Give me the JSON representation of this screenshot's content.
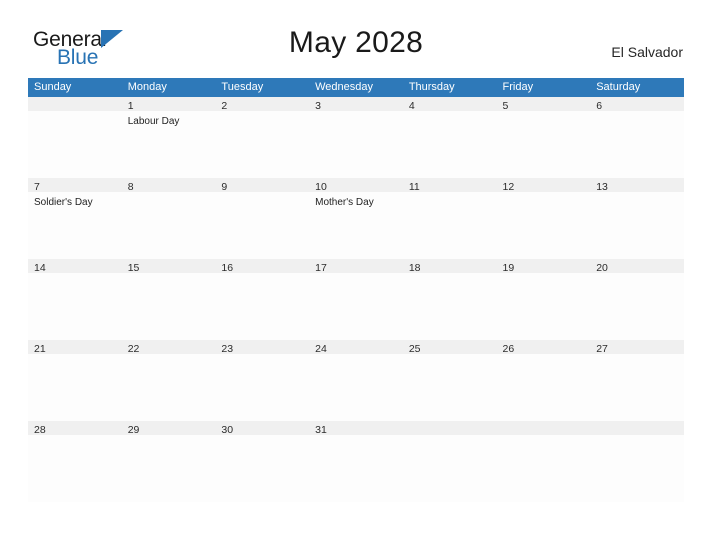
{
  "brand": {
    "name_part1": "General",
    "name_part2": "Blue",
    "color_primary": "#2873b4",
    "logo_icon": "triangle-flag-icon"
  },
  "header": {
    "title": "May 2028",
    "country": "El Salvador"
  },
  "calendar": {
    "month": "May",
    "year": "2028",
    "header_bg": "#2e79b9",
    "daynum_band_bg": "#f0f0f0",
    "weekday_headers": [
      "Sunday",
      "Monday",
      "Tuesday",
      "Wednesday",
      "Thursday",
      "Friday",
      "Saturday"
    ],
    "weeks": [
      [
        {
          "day": "",
          "events": []
        },
        {
          "day": "1",
          "events": [
            "Labour Day"
          ]
        },
        {
          "day": "2",
          "events": []
        },
        {
          "day": "3",
          "events": []
        },
        {
          "day": "4",
          "events": []
        },
        {
          "day": "5",
          "events": []
        },
        {
          "day": "6",
          "events": []
        }
      ],
      [
        {
          "day": "7",
          "events": [
            "Soldier's Day"
          ]
        },
        {
          "day": "8",
          "events": []
        },
        {
          "day": "9",
          "events": []
        },
        {
          "day": "10",
          "events": [
            "Mother's Day"
          ]
        },
        {
          "day": "11",
          "events": []
        },
        {
          "day": "12",
          "events": []
        },
        {
          "day": "13",
          "events": []
        }
      ],
      [
        {
          "day": "14",
          "events": []
        },
        {
          "day": "15",
          "events": []
        },
        {
          "day": "16",
          "events": []
        },
        {
          "day": "17",
          "events": []
        },
        {
          "day": "18",
          "events": []
        },
        {
          "day": "19",
          "events": []
        },
        {
          "day": "20",
          "events": []
        }
      ],
      [
        {
          "day": "21",
          "events": []
        },
        {
          "day": "22",
          "events": []
        },
        {
          "day": "23",
          "events": []
        },
        {
          "day": "24",
          "events": []
        },
        {
          "day": "25",
          "events": []
        },
        {
          "day": "26",
          "events": []
        },
        {
          "day": "27",
          "events": []
        }
      ],
      [
        {
          "day": "28",
          "events": []
        },
        {
          "day": "29",
          "events": []
        },
        {
          "day": "30",
          "events": []
        },
        {
          "day": "31",
          "events": []
        },
        {
          "day": "",
          "events": []
        },
        {
          "day": "",
          "events": []
        },
        {
          "day": "",
          "events": []
        }
      ]
    ]
  }
}
